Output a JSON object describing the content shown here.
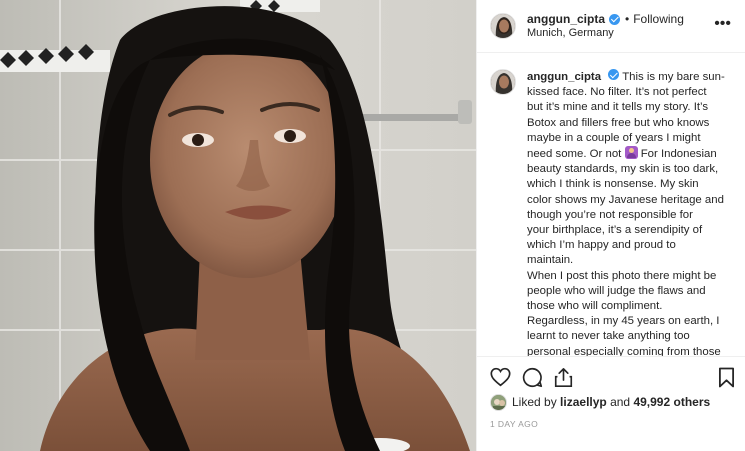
{
  "post": {
    "author": "anggun_cipta",
    "following_label": "Following",
    "separator": "•",
    "location": "Munich, Germany",
    "more_icon": "more-options-icon",
    "more_glyph": "•••",
    "caption_lines": [
      "This is my bare sun-",
      "kissed face. No filter. It’s not perfect",
      "but it’s mine and it tells my story. It’s",
      "Botox and fillers free but who knows",
      "maybe in a couple of years I might",
      "need some. Or not",
      "For Indonesian",
      "beauty standards, my skin is too dark,",
      "which I think is nonsense. My skin",
      "color shows my Javanese heritage and",
      "though you’re not responsible for",
      "your birthplace, it’s a serendipity of",
      "which I’m happy and proud to",
      "maintain.",
      "When I post this photo there might be",
      "people who will judge the flaws and",
      "those who will compliment.",
      "Regardless, in my 45 years on earth, I",
      "learnt to never take anything too",
      "personal especially coming from those"
    ],
    "likes": {
      "prefix": "Liked by",
      "user": "lizaellyp",
      "conjunction": "and",
      "count_label": "49,992 others"
    },
    "timestamp": "1 DAY AGO"
  },
  "icons": {
    "verified": "verified-badge-icon",
    "like": "heart-icon",
    "comment": "comment-icon",
    "share": "share-icon",
    "save": "bookmark-icon",
    "emoji": "woman-gesturing-no-emoji"
  },
  "colors": {
    "verified_blue": "#3897f0",
    "text": "#262626",
    "muted": "#999999",
    "divider": "#efefef"
  }
}
